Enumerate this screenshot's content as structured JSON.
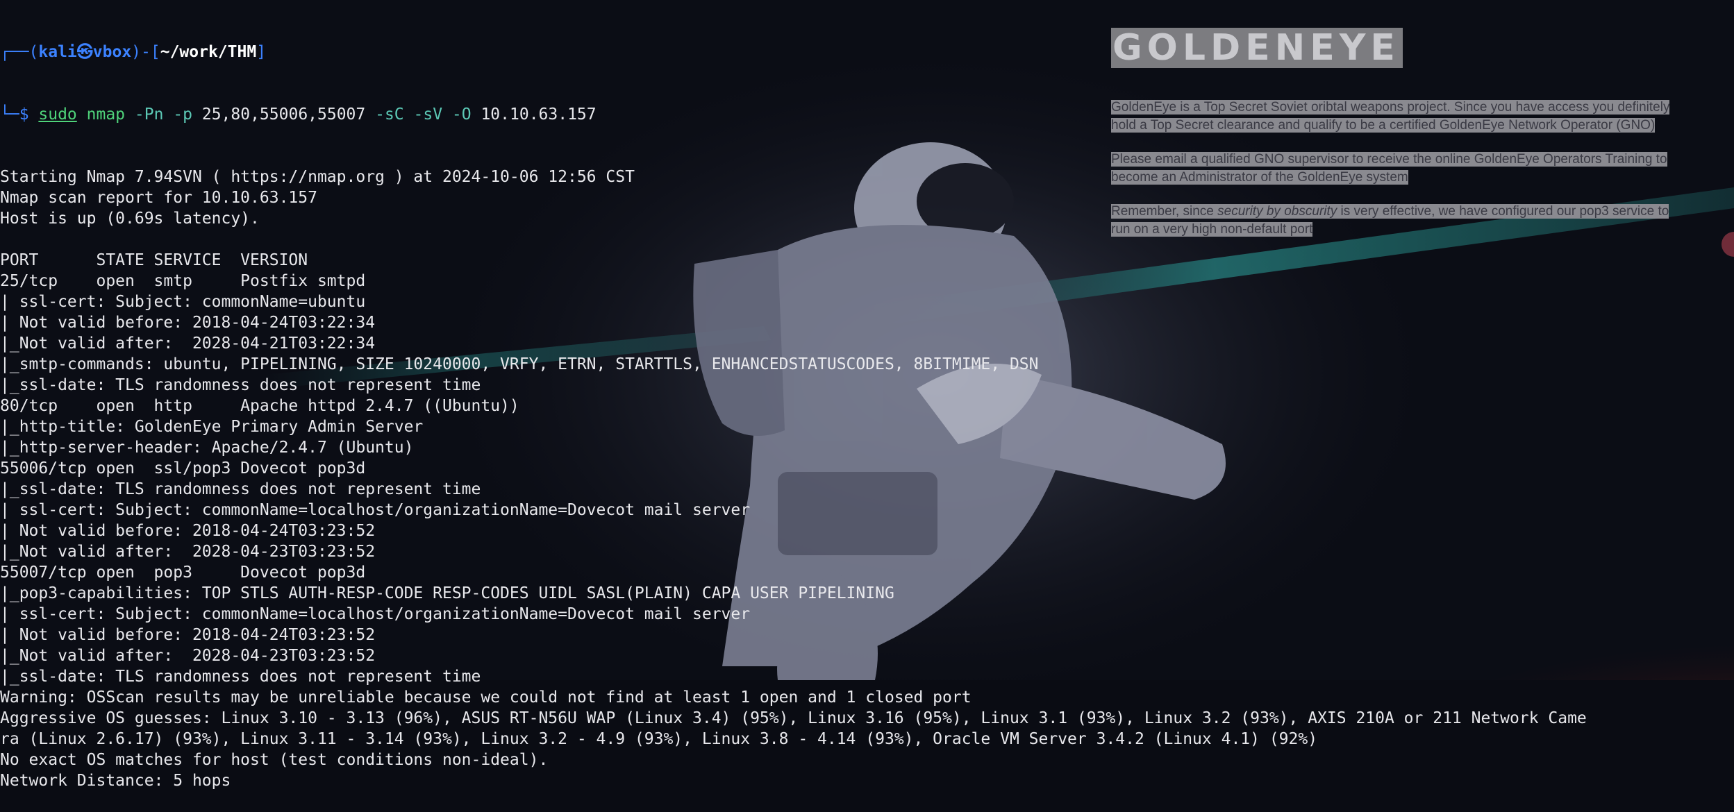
{
  "prompt": {
    "corner": "┌──(",
    "user": "kali",
    "symbol": "㉿",
    "host": "vbox",
    "sep": ")-[",
    "path": "~/work/THM",
    "close": "]",
    "arrow": "└─$ "
  },
  "command": {
    "sudo": "sudo",
    "program": "nmap",
    "flags_a": "-Pn -p",
    "ports": "25,80,55006,55007",
    "flags_b": "-sC -sV -O",
    "target": "10.10.63.157"
  },
  "output": [
    "Starting Nmap 7.94SVN ( https://nmap.org ) at 2024-10-06 12:56 CST",
    "Nmap scan report for 10.10.63.157",
    "Host is up (0.69s latency).",
    "",
    "PORT      STATE SERVICE  VERSION",
    "25/tcp    open  smtp     Postfix smtpd",
    "| ssl-cert: Subject: commonName=ubuntu",
    "| Not valid before: 2018-04-24T03:22:34",
    "|_Not valid after:  2028-04-21T03:22:34",
    "|_smtp-commands: ubuntu, PIPELINING, SIZE 10240000, VRFY, ETRN, STARTTLS, ENHANCEDSTATUSCODES, 8BITMIME, DSN",
    "|_ssl-date: TLS randomness does not represent time",
    "80/tcp    open  http     Apache httpd 2.4.7 ((Ubuntu))",
    "|_http-title: GoldenEye Primary Admin Server",
    "|_http-server-header: Apache/2.4.7 (Ubuntu)",
    "55006/tcp open  ssl/pop3 Dovecot pop3d",
    "|_ssl-date: TLS randomness does not represent time",
    "| ssl-cert: Subject: commonName=localhost/organizationName=Dovecot mail server",
    "| Not valid before: 2018-04-24T03:23:52",
    "|_Not valid after:  2028-04-23T03:23:52",
    "55007/tcp open  pop3     Dovecot pop3d",
    "|_pop3-capabilities: TOP STLS AUTH-RESP-CODE RESP-CODES UIDL SASL(PLAIN) CAPA USER PIPELINING",
    "| ssl-cert: Subject: commonName=localhost/organizationName=Dovecot mail server",
    "| Not valid before: 2018-04-24T03:23:52",
    "|_Not valid after:  2028-04-23T03:23:52",
    "|_ssl-date: TLS randomness does not represent time",
    "Warning: OSScan results may be unreliable because we could not find at least 1 open and 1 closed port",
    "Aggressive OS guesses: Linux 3.10 - 3.13 (96%), ASUS RT-N56U WAP (Linux 3.4) (95%), Linux 3.16 (95%), Linux 3.1 (93%), Linux 3.2 (93%), AXIS 210A or 211 Network Came",
    "ra (Linux 2.6.17) (93%), Linux 3.11 - 3.14 (93%), Linux 3.2 - 4.9 (93%), Linux 3.8 - 4.14 (93%), Oracle VM Server 3.4.2 (Linux 4.1) (92%)",
    "No exact OS matches for host (test conditions non-ideal).",
    "Network Distance: 5 hops"
  ],
  "goldeneye": {
    "title": "GOLDENEYE",
    "p1_line1": "GoldenEye is a Top Secret Soviet oribtal weapons project. Since you have access you definitely",
    "p1_line2": "hold a Top Secret clearance and qualify to be a certified GoldenEye Network Operator (GNO)",
    "p2_line1": "Please email a qualified GNO supervisor to receive the online GoldenEye Operators Training to",
    "p2_line2": "become an Administrator of the GoldenEye system",
    "p3_pre": "Remember, since ",
    "p3_em": "security by obscurity",
    "p3_post": " is very effective, we have configured our pop3 service to",
    "p3_line2": "run on a very high non-default port"
  },
  "colors": {
    "background": "#0a0c13",
    "prompt_blue": "#3c82ff",
    "command_green": "#4fd37a",
    "flag_teal": "#5cc9b6",
    "text": "#e8e8ec"
  }
}
